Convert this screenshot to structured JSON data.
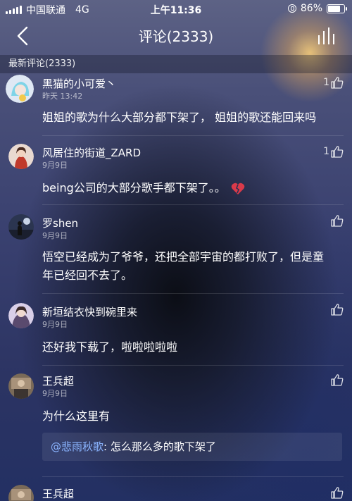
{
  "status_bar": {
    "carrier": "中国联通",
    "network": "4G",
    "time": "上午11:36",
    "battery": "86%",
    "battery_level": 0.86
  },
  "nav": {
    "title": "评论(2333)"
  },
  "section": {
    "title": "最新评论(2333)"
  },
  "comments": [
    {
      "user": "黑猫的小可爱丶",
      "time": "昨天 13:42",
      "likes": "1",
      "text": "姐姐的歌为什么大部分都下架了， 姐姐的歌还能回来吗"
    },
    {
      "user": "风居住的街道_ZARD",
      "time": "9月9日",
      "likes": "1",
      "text": "being公司的大部分歌手都下架了。。"
    },
    {
      "user": "罗shen",
      "time": "9月9日",
      "likes": "",
      "text_line1": "悟空已经成为了爷爷，还把全部宇宙的都打败了，但是童",
      "text_line2": "年已经回不去了。"
    },
    {
      "user": "新垣结衣快到碗里来",
      "time": "9月9日",
      "likes": "",
      "text": "还好我下载了，啦啦啦啦啦"
    },
    {
      "user": "王兵超",
      "time": "9月9日",
      "likes": "",
      "text": "为什么这里有",
      "reply_user": "@悲雨秋歌",
      "reply_text": ": 怎么那么多的歌下架了"
    },
    {
      "user": "王兵超",
      "likes": ""
    }
  ],
  "icons": {
    "back": "chevron-left-icon",
    "chart": "bar-chart-icon",
    "like": "thumbs-up-icon",
    "emoji": "broken-heart-icon"
  },
  "colors": {
    "reply_user": "#8ab4ff",
    "broken_heart": "#d93a4a"
  }
}
